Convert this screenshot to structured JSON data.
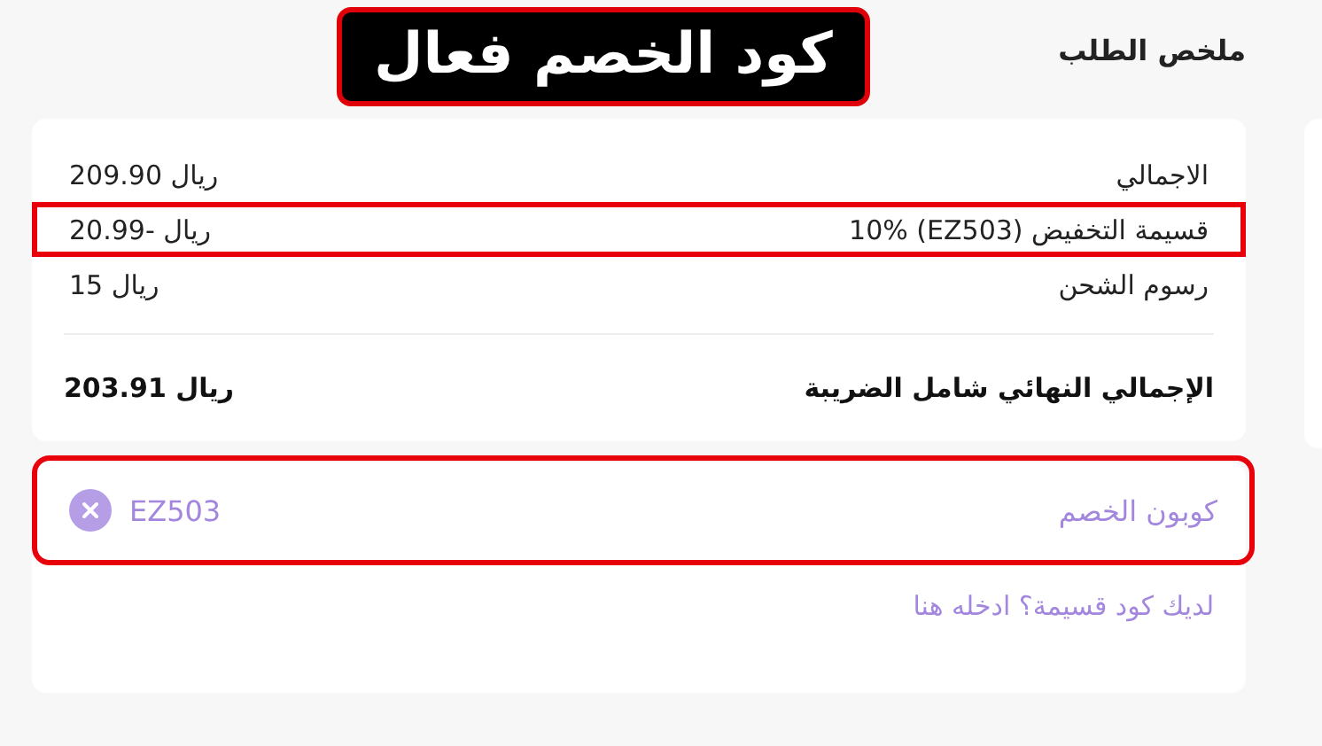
{
  "annotation": {
    "label": "كود الخصم فعال"
  },
  "summary": {
    "title": "ملخص الطلب",
    "rows": [
      {
        "label": "الاجمالي",
        "value": "209.90 ريال",
        "highlighted": false
      },
      {
        "label": "قسيمة التخفيض (EZ503) 10%",
        "value": "20.99- ريال",
        "highlighted": true
      },
      {
        "label": "رسوم الشحن",
        "value": "15 ريال",
        "highlighted": false
      }
    ],
    "total": {
      "label": "الإجمالي النهائي شامل الضريبة",
      "value": "203.91 ريال"
    }
  },
  "coupon": {
    "label": "كوبون الخصم",
    "value": "EZ503",
    "highlighted": true,
    "link": "لديك كود قسيمة؟ ادخله هنا"
  }
}
